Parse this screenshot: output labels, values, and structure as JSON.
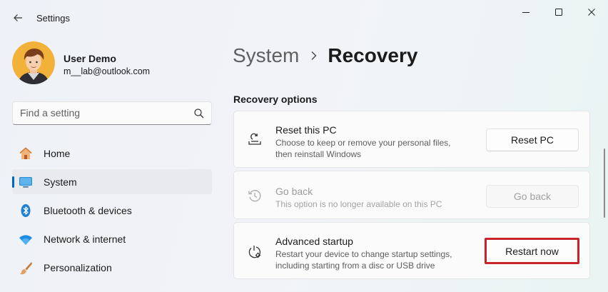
{
  "window": {
    "title": "Settings"
  },
  "user": {
    "name": "User Demo",
    "email": "m__lab@outlook.com"
  },
  "search": {
    "placeholder": "Find a setting"
  },
  "sidebar": {
    "items": [
      {
        "label": "Home",
        "icon": "home-icon",
        "active": false
      },
      {
        "label": "System",
        "icon": "system-icon",
        "active": true
      },
      {
        "label": "Bluetooth & devices",
        "icon": "bluetooth-icon",
        "active": false
      },
      {
        "label": "Network & internet",
        "icon": "wifi-icon",
        "active": false
      },
      {
        "label": "Personalization",
        "icon": "brush-icon",
        "active": false
      }
    ]
  },
  "breadcrumb": {
    "parent": "System",
    "current": "Recovery"
  },
  "recovery": {
    "section_title": "Recovery options",
    "options": [
      {
        "title": "Reset this PC",
        "description": "Choose to keep or remove your personal files, then reinstall Windows",
        "button": "Reset PC",
        "icon": "reset-pc-icon",
        "enabled": true
      },
      {
        "title": "Go back",
        "description": "This option is no longer available on this PC",
        "button": "Go back",
        "icon": "history-icon",
        "enabled": false
      },
      {
        "title": "Advanced startup",
        "description": "Restart your device to change startup settings, including starting from a disc or USB drive",
        "button": "Restart now",
        "icon": "advanced-startup-icon",
        "enabled": true,
        "highlighted": true
      }
    ]
  },
  "colors": {
    "accent": "#0067c0",
    "highlight": "#c8252b"
  }
}
